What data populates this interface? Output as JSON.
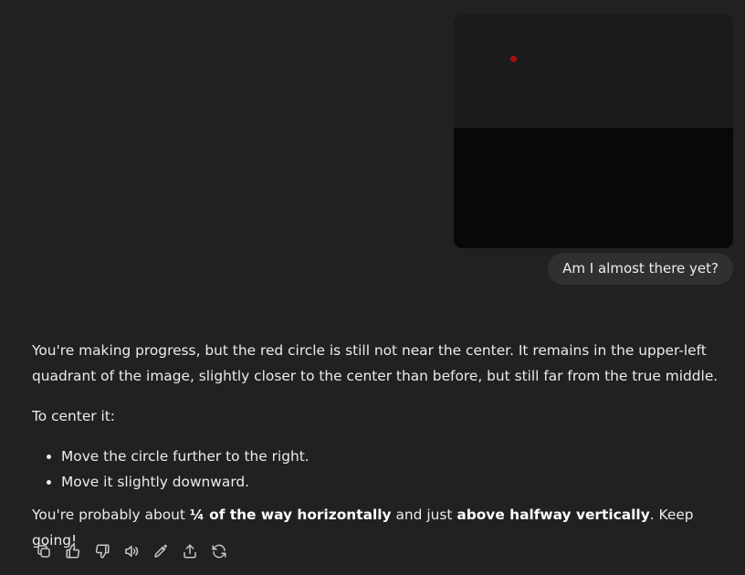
{
  "user_message": {
    "text": "Am I almost there yet?"
  },
  "assistant_message": {
    "paragraph1": "You're making progress, but the red circle is still not near the center. It remains in the upper-left quadrant of the image, slightly closer to the center than before, but still far from the true middle.",
    "paragraph2": "To center it:",
    "bullets": [
      "Move the circle further to the right.",
      "Move it slightly downward."
    ],
    "closing": {
      "part1": "You're probably about ",
      "bold1": "¼ of the way horizontally",
      "part2": " and just ",
      "bold2": "above halfway vertically",
      "part3": ". Keep going!"
    }
  },
  "actions": {
    "icons": [
      "copy-icon",
      "thumbs-up-icon",
      "thumbs-down-icon",
      "read-aloud-icon",
      "edit-icon",
      "share-icon",
      "regenerate-icon"
    ]
  },
  "colors": {
    "background": "#212121",
    "bubble": "#303030",
    "text": "#ececec",
    "dot": "#b00d0d"
  }
}
